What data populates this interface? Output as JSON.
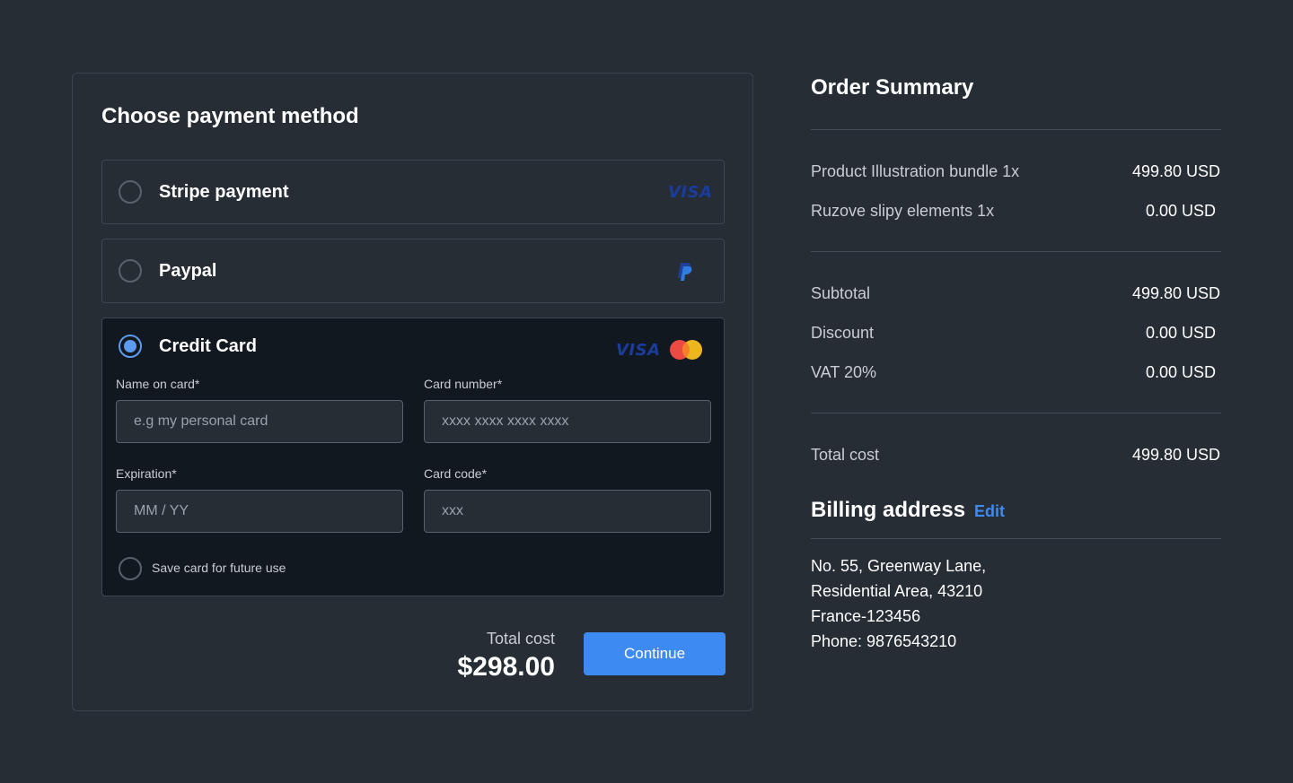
{
  "payment": {
    "title": "Choose payment method",
    "options": [
      {
        "label": "Stripe payment",
        "logo": "visa-logo",
        "logo_text": "VISA"
      },
      {
        "label": "Paypal",
        "logo": "paypal-logo"
      },
      {
        "label": "Credit Card",
        "logo": "visa-logo",
        "logo_text": "VISA",
        "selected": true
      }
    ],
    "form": {
      "name_label": "Name on card*",
      "name_placeholder": "e.g my personal card",
      "number_label": "Card number*",
      "number_placeholder": "xxxx xxxx xxxx xxxx",
      "expiration_label": "Expiration*",
      "expiration_placeholder": "MM / YY",
      "code_label": "Card code*",
      "code_placeholder": "xxx",
      "save_label": "Save card for future use"
    },
    "total_label": "Total cost",
    "total_value": "$298.00",
    "continue_label": "Continue"
  },
  "summary": {
    "title": "Order Summary",
    "items": [
      {
        "label": "Product Illustration bundle 1x",
        "value": "499.80 USD"
      },
      {
        "label": "Ruzove slipy elements 1x",
        "value": "0.00 USD"
      }
    ],
    "subtotal_label": "Subtotal",
    "subtotal_value": "499.80 USD",
    "discount_label": "Discount",
    "discount_value": "0.00 USD",
    "vat_label": "VAT 20%",
    "vat_value": "0.00 USD",
    "total_label": "Total cost",
    "total_value": "499.80 USD"
  },
  "billing": {
    "title": "Billing address",
    "edit_label": "Edit",
    "address": [
      "No. 55, Greenway Lane,",
      "Residential Area, 43210",
      "France-123456",
      "Phone: 9876543210"
    ]
  },
  "colors": {
    "background": "#262d35",
    "accent": "#3d8bf2",
    "card_bg": "#111820"
  }
}
